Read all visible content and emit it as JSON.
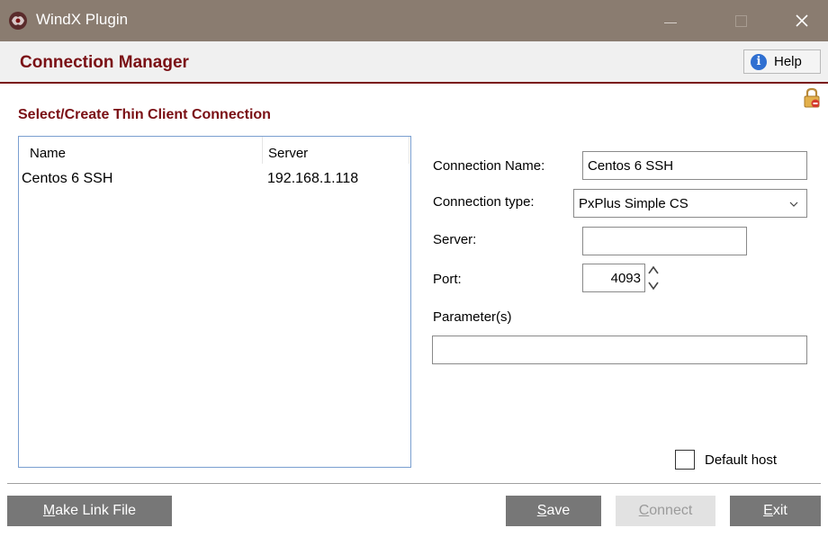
{
  "window": {
    "title": "WindX Plugin"
  },
  "header": {
    "title": "Connection Manager",
    "help_label": "Help"
  },
  "section": {
    "heading": "Select/Create Thin Client Connection"
  },
  "list": {
    "columns": {
      "name": "Name",
      "server": "Server"
    },
    "rows": [
      {
        "name": "Centos 6 SSH",
        "server": "192.168.1.118"
      }
    ]
  },
  "form": {
    "connection_name": {
      "label": "Connection Name:",
      "value": "Centos 6 SSH"
    },
    "connection_type": {
      "label": "Connection type:",
      "value": "PxPlus Simple CS"
    },
    "server": {
      "label": "Server:",
      "value": ""
    },
    "port": {
      "label": "Port:",
      "value": "4093"
    },
    "parameters": {
      "label": "Parameter(s)",
      "value": ""
    },
    "default_host": {
      "label": "Default host",
      "checked": false
    }
  },
  "buttons": {
    "make_link_first": "M",
    "make_link_rest": "ake Link File",
    "save_first": "S",
    "save_rest": "ave",
    "connect_first": "C",
    "connect_rest": "onnect",
    "exit_first": "E",
    "exit_rest": "xit"
  },
  "colors": {
    "titlebar": "#8a7c70",
    "accent": "#7a0f14",
    "button": "#777777"
  }
}
